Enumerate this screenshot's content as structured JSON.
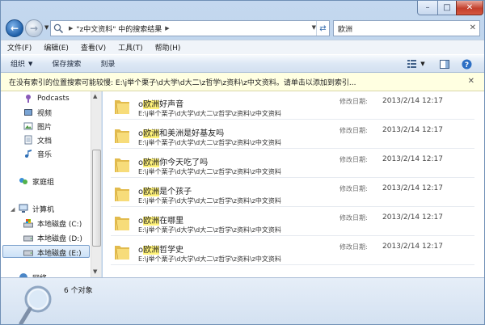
{
  "address": {
    "path": "\"z中文资料\" 中的搜索结果"
  },
  "search": {
    "value": "欧洲"
  },
  "menu": [
    "文件(F)",
    "编辑(E)",
    "查看(V)",
    "工具(T)",
    "帮助(H)"
  ],
  "commands": {
    "organize": "组织",
    "save_search": "保存搜索",
    "burn": "刻录"
  },
  "infobar": {
    "text": "在没有索引的位置搜索可能较慢: E:\\j举个栗子\\d大学\\d大二\\z哲学\\z资料\\z中文资料。请单击以添加到索引..."
  },
  "nav": {
    "items": [
      {
        "label": "Podcasts"
      },
      {
        "label": "视频"
      },
      {
        "label": "图片"
      },
      {
        "label": "文档"
      },
      {
        "label": "音乐"
      },
      {
        "label": "家庭组"
      },
      {
        "label": "计算机"
      },
      {
        "label": "本地磁盘 (C:)"
      },
      {
        "label": "本地磁盘 (D:)"
      },
      {
        "label": "本地磁盘 (E:)"
      },
      {
        "label": "网络"
      }
    ]
  },
  "results": {
    "date_label": "修改日期:",
    "items": [
      {
        "prefix": "o",
        "highlight": "欧洲",
        "rest": "好声音",
        "path": "E:\\j举个栗子\\d大学\\d大二\\z哲学\\z资料\\z中文资料",
        "date": "2013/2/14 12:17"
      },
      {
        "prefix": "o",
        "highlight": "欧洲",
        "rest": "和美洲是好基友吗",
        "path": "E:\\j举个栗子\\d大学\\d大二\\z哲学\\z资料\\z中文资料",
        "date": "2013/2/14 12:17"
      },
      {
        "prefix": "o",
        "highlight": "欧洲",
        "rest": "你今天吃了吗",
        "path": "E:\\j举个栗子\\d大学\\d大二\\z哲学\\z资料\\z中文资料",
        "date": "2013/2/14 12:17"
      },
      {
        "prefix": "o",
        "highlight": "欧洲",
        "rest": "是个孩子",
        "path": "E:\\j举个栗子\\d大学\\d大二\\z哲学\\z资料\\z中文资料",
        "date": "2013/2/14 12:17"
      },
      {
        "prefix": "o",
        "highlight": "欧洲",
        "rest": "在哪里",
        "path": "E:\\j举个栗子\\d大学\\d大二\\z哲学\\z资料\\z中文资料",
        "date": "2013/2/14 12:17"
      },
      {
        "prefix": "o",
        "highlight": "欧洲",
        "rest": "哲学史",
        "path": "E:\\j举个栗子\\d大学\\d大二\\z哲学\\z资料\\z中文资料",
        "date": "2013/2/14 12:17"
      }
    ]
  },
  "status": {
    "count": "6 个对象"
  },
  "icons": {
    "back": "back-arrow-icon",
    "forward": "forward-arrow-icon",
    "folder": "folder-icon",
    "search": "search-icon"
  },
  "colors": {
    "highlight": "#fff27a",
    "accent": "#1f5fa8",
    "infobar": "#ffffe1"
  }
}
